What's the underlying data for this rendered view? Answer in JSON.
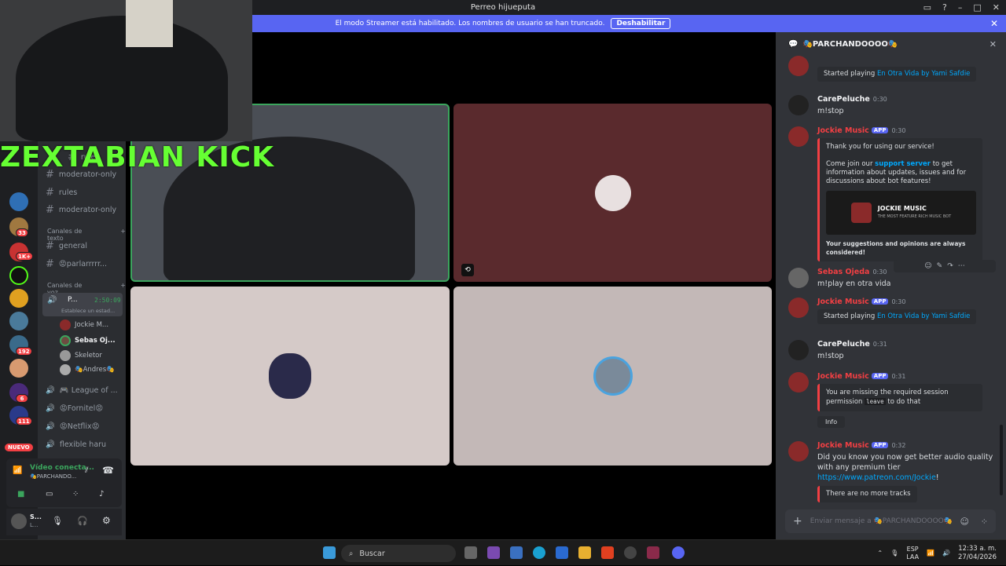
{
  "window": {
    "title": "Perreo hijueputa"
  },
  "banner": {
    "text": "El modo Streamer está habilitado. Los nombres de usuario se han truncado.",
    "button": "Deshabilitar"
  },
  "overlay": {
    "text": "ZEXTABIAN  KICK"
  },
  "servers": {
    "badges": [
      "33",
      "1K+",
      "192",
      "6",
      "111"
    ],
    "new_label": "NUEVO"
  },
  "channels": {
    "top_items": [
      "rules",
      "moderator-only",
      "rules",
      "moderator-only"
    ],
    "text_category": "Canales de texto",
    "text_channels": [
      "general",
      "😡parlarrrrr..."
    ],
    "voice_category": "Canales de voz",
    "active_voice": {
      "name": "P...",
      "timer": "2:50:09",
      "status": "Establece un estad..."
    },
    "voice_users": [
      "Jockie M...",
      "Sebas Oj...",
      "Skeletor",
      "🎭Andres🎭"
    ],
    "voice_channels": [
      "🎮 League of ...",
      "😡Fornitel😡",
      "😡Netflix😡",
      "flexible haru"
    ]
  },
  "voice_panel": {
    "status": "Vídeo conecta...",
    "channel": "🎭PARCHANDO..."
  },
  "user_panel": {
    "name": "S...",
    "sub": "L..."
  },
  "chat": {
    "channel_name": "🎭PARCHANDOOOO🎭",
    "messages": [
      {
        "embed": "Started playing",
        "embed_link": "En Otra Vida by Yami Safdie"
      },
      {
        "author": "CarePeluche",
        "time": "0:30",
        "text": "m!stop"
      },
      {
        "author": "Jockie Music",
        "tag": "APP",
        "time": "0:30",
        "embed_lines": [
          "Thank you for using our service!",
          "Come join our",
          "support server",
          "to get information about updates, issues and for discussions about bot features!"
        ],
        "banner_title": "JOCKIE MUSIC",
        "banner_sub": "THE MOST FEATURE RICH MUSIC BOT",
        "footer": "Your suggestions and opinions are always considered!"
      },
      {
        "author": "Sebas Ojeda",
        "time": "0:30",
        "text": "m!play en otra vida"
      },
      {
        "author": "Jockie Music",
        "tag": "APP",
        "time": "0:30",
        "embed": "Started playing",
        "embed_link": "En Otra Vida by Yami Safdie"
      },
      {
        "author": "CarePeluche",
        "time": "0:31",
        "text": "m!stop"
      },
      {
        "author": "Jockie Music",
        "tag": "APP",
        "time": "0:31",
        "embed": "You are missing the required session permission",
        "code": "leave",
        "embed_tail": "to do that",
        "button": "Info"
      },
      {
        "author": "Jockie Music",
        "tag": "APP",
        "time": "0:32",
        "text": "Did you know you now get better audio quality with any premium tier",
        "link": "https://www.patreon.com/Jockie",
        "embed": "There are no more tracks"
      }
    ],
    "input_placeholder": "Enviar mensaje a 🎭PARCHANDOOOO🎭"
  },
  "taskbar": {
    "search": "Buscar",
    "lang": "ESP",
    "lang2": "LAA",
    "time": "12:33 a. m.",
    "date": "27/04/2026"
  },
  "colors": {
    "accent": "#5865f2",
    "bot": "#f23f43",
    "speaking": "#3ba55d"
  }
}
